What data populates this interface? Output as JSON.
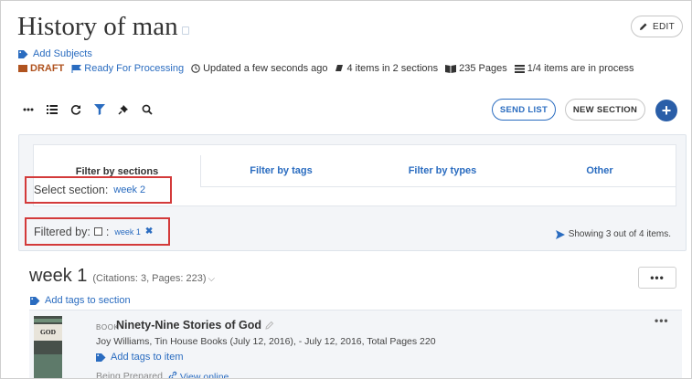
{
  "header": {
    "title": "History of man",
    "edit_label": "EDIT",
    "add_subjects": "Add Subjects"
  },
  "status": {
    "draft": "DRAFT",
    "ready": "Ready For Processing",
    "updated": "Updated a few seconds ago",
    "items_sections": "4 items in 2 sections",
    "pages": "235 Pages",
    "in_process": "1/4 items are in process"
  },
  "toolbar": {
    "send_list": "SEND LIST",
    "new_section": "NEW SECTION",
    "add": "+"
  },
  "filter": {
    "tabs": [
      "Filter by sections",
      "Filter by tags",
      "Filter by types",
      "Other"
    ],
    "select_section_label": "Select section:",
    "select_section_value": "week 2",
    "filtered_by_label": "Filtered by:",
    "filtered_by_colon": ":",
    "filtered_tag": "week 1",
    "remove_symbol": "✖",
    "showing": "Showing 3 out of 4 items."
  },
  "section": {
    "title": "week 1",
    "meta": "(Citations: 3, Pages: 223)",
    "chevron": "⌵",
    "menu": "•••",
    "add_tags": "Add tags to section"
  },
  "item": {
    "type": "BOOK",
    "title": "Ninety-Nine Stories of God",
    "details": "Joy Williams, Tin House Books (July 12, 2016), - July 12, 2016, Total Pages 220",
    "add_tags": "Add tags to item",
    "status": "Being Prepared",
    "view_online": "View online",
    "menu": "•••",
    "cover_text": "GOD"
  },
  "colors": {
    "link": "#2a6cc0",
    "draft": "#b0531f",
    "highlight_border": "#d33a3a",
    "add_button": "#2a5ea8"
  }
}
